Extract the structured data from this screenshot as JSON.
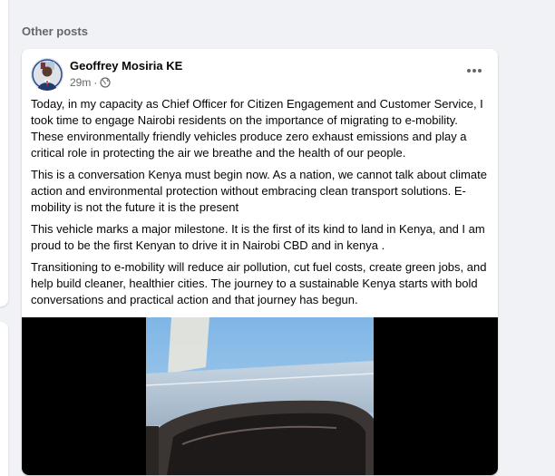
{
  "section": {
    "title": "Other posts"
  },
  "post": {
    "author": "Geoffrey Mosiria KE",
    "time": "29m",
    "separator": "·",
    "paragraphs": [
      "Today, in my capacity as Chief Officer for Citizen Engagement and Customer Service, I took time to engage Nairobi residents on the importance of migrating to e-mobility. These environmentally friendly vehicles produce zero exhaust emissions and play a critical role in protecting the air we breathe and the health of our people.",
      "This is a conversation Kenya must begin now. As a nation, we cannot talk about climate action and environmental protection without embracing clean transport solutions. E-mobility is not the future it is the present",
      "This vehicle marks a major milestone. It is the first of its kind to land in Kenya, and I am proud to be the first Kenyan to drive it in Nairobi CBD and in kenya .",
      "Transitioning to e-mobility will reduce air pollution, cut fuel costs, create green jobs, and help build cleaner, healthier cities. The journey to a sustainable Kenya starts with bold conversations and practical action and that journey has begun."
    ],
    "icons": {
      "audience": "globe-icon",
      "menu": "more-horizontal-icon"
    }
  },
  "colors": {
    "page_background": "#f0f2f5",
    "card_background": "#ffffff",
    "secondary_text": "#65676b",
    "primary_text": "#050505",
    "media_letterbox": "#000000"
  }
}
